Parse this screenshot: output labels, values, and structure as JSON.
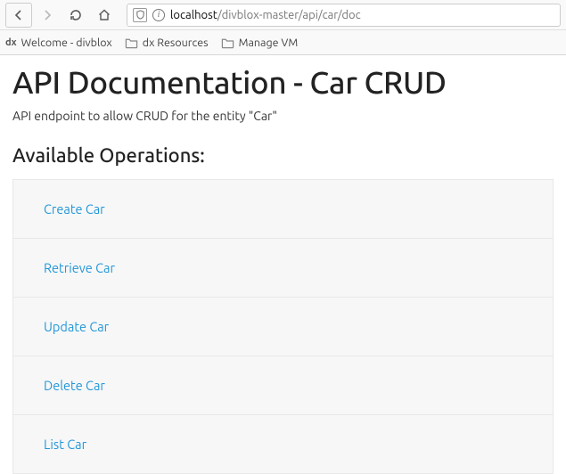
{
  "browser": {
    "url_host": "localhost",
    "url_path": "/divblox-master/api/car/doc"
  },
  "bookmarks": [
    {
      "label": "Welcome - divblox",
      "icon": "dx"
    },
    {
      "label": "dx Resources",
      "icon": "folder"
    },
    {
      "label": "Manage VM",
      "icon": "folder"
    }
  ],
  "page": {
    "title": "API Documentation - Car CRUD",
    "subtitle": "API endpoint to allow CRUD for the entity \"Car\"",
    "section_heading": "Available Operations:"
  },
  "operations": [
    {
      "label": "Create Car"
    },
    {
      "label": "Retrieve Car"
    },
    {
      "label": "Update Car"
    },
    {
      "label": "Delete Car"
    },
    {
      "label": "List Car"
    }
  ]
}
